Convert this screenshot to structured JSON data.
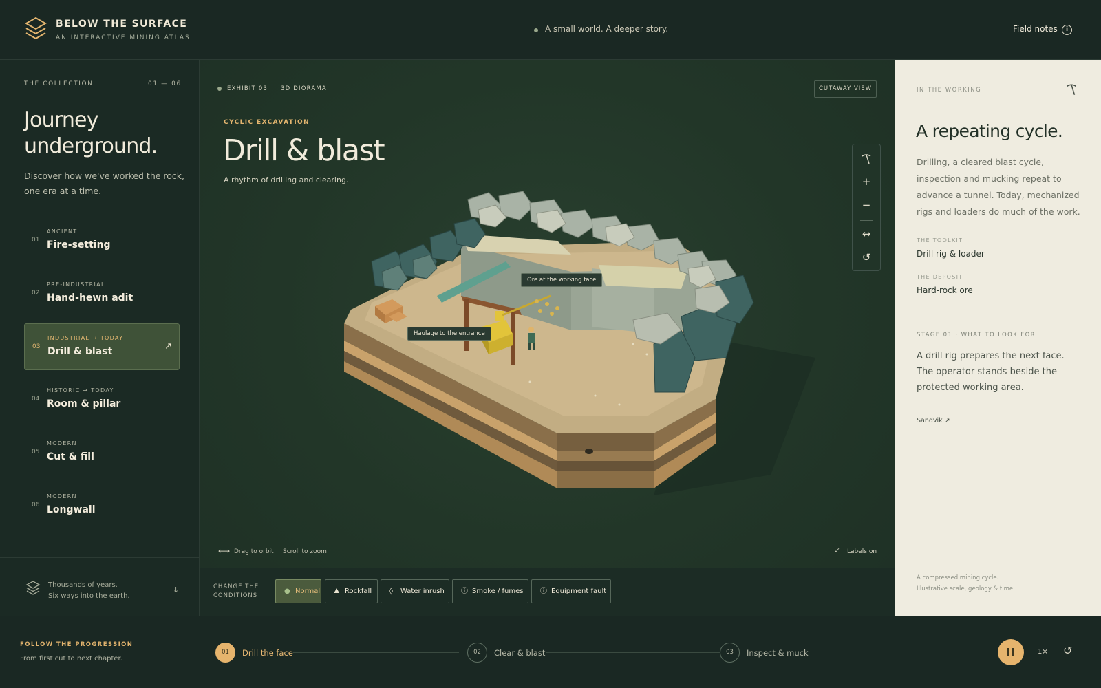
{
  "header": {
    "brand_title": "BELOW THE SURFACE",
    "brand_subtitle": "AN INTERACTIVE MINING ATLAS",
    "tagline": "A small world. A deeper story.",
    "field_notes": "Field notes"
  },
  "sidebar": {
    "collection_label": "THE COLLECTION",
    "collection_range": "01 — 06",
    "heading": "Journey underground.",
    "description": "Discover how we've worked the rock, one era at a time.",
    "eras": [
      {
        "num": "01",
        "kicker": "ANCIENT",
        "name": "Fire-setting"
      },
      {
        "num": "02",
        "kicker": "PRE-INDUSTRIAL",
        "name": "Hand-hewn adit"
      },
      {
        "num": "03",
        "kicker": "INDUSTRIAL → TODAY",
        "name": "Drill & blast",
        "active": true,
        "arrow": "↗"
      },
      {
        "num": "04",
        "kicker": "HISTORIC → TODAY",
        "name": "Room & pillar"
      },
      {
        "num": "05",
        "kicker": "MODERN",
        "name": "Cut & fill"
      },
      {
        "num": "06",
        "kicker": "MODERN",
        "name": "Longwall"
      }
    ],
    "footer_line1": "Thousands of years.",
    "footer_line2": "Six ways into the earth."
  },
  "viewer": {
    "exhibit": "EXHIBIT 03",
    "exhibit_type": "3D DIORAMA",
    "cutaway": "CUTAWAY VIEW",
    "kicker": "CYCLIC EXCAVATION",
    "title": "Drill & blast",
    "subtitle": "A rhythm of drilling and clearing.",
    "tools": [
      "pickaxe-icon",
      "zoom-in-icon",
      "zoom-out-icon",
      "orbit-icon",
      "reset-icon"
    ],
    "scene_labels": {
      "ore": "Ore at the working face",
      "haulage": "Haulage to the entrance"
    },
    "hint_orbit": "Drag to orbit",
    "hint_zoom": "Scroll to zoom",
    "labels_toggle": "Labels on"
  },
  "conditions": {
    "label_line1": "CHANGE THE",
    "label_line2": "CONDITIONS",
    "options": [
      {
        "label": "Normal",
        "icon": "dot-icon",
        "active": true
      },
      {
        "label": "Rockfall",
        "icon": "mountain-icon"
      },
      {
        "label": "Water inrush",
        "icon": "droplet-icon"
      },
      {
        "label": "Smoke / fumes",
        "icon": "info-icon"
      },
      {
        "label": "Equipment fault",
        "icon": "info-icon"
      }
    ]
  },
  "panel": {
    "label": "IN THE WORKING",
    "title": "A repeating cycle.",
    "description": "Drilling, a cleared blast cycle, inspection and mucking repeat to advance a tunnel. Today, mechanized rigs and loaders do much of the work.",
    "toolkit_label": "THE TOOLKIT",
    "toolkit_value": "Drill rig & loader",
    "deposit_label": "THE DEPOSIT",
    "deposit_value": "Hard-rock ore",
    "stage_label": "STAGE 01 · WHAT TO LOOK FOR",
    "stage_description": "A drill rig prepares the next face. The operator stands beside the protected working area.",
    "source_link": "Sandvik ↗",
    "note_line1": "A compressed mining cycle.",
    "note_line2": "Illustrative scale, geology & time."
  },
  "progression": {
    "label": "FOLLOW THE PROGRESSION",
    "sub": "From first cut to next chapter.",
    "steps": [
      {
        "num": "01",
        "label": "Drill the face",
        "active": true
      },
      {
        "num": "02",
        "label": "Clear & blast"
      },
      {
        "num": "03",
        "label": "Inspect & muck"
      }
    ],
    "speed": "1×"
  },
  "colors": {
    "background": "#1b2a24",
    "accent": "#e6b46d",
    "panel": "#efece0",
    "active_era": "#3f5238"
  }
}
